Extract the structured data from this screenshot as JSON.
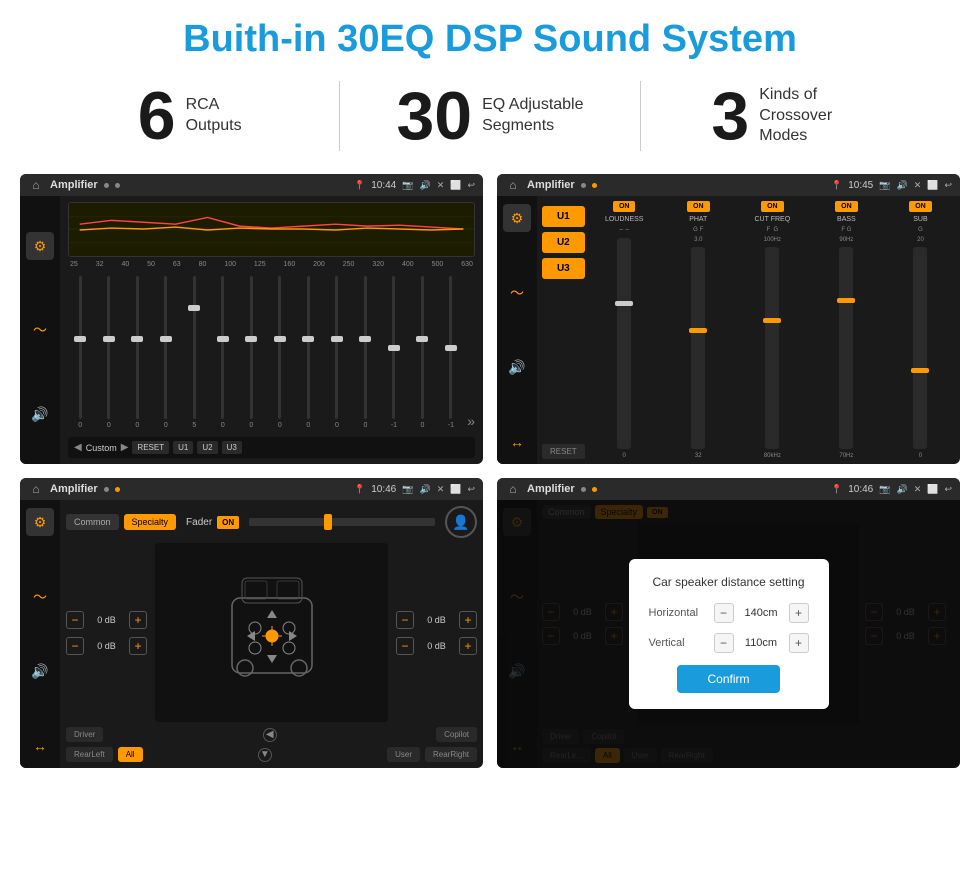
{
  "header": {
    "title": "Buith-in 30EQ DSP Sound System"
  },
  "stats": [
    {
      "number": "6",
      "label": "RCA\nOutputs"
    },
    {
      "number": "30",
      "label": "EQ Adjustable\nSegments"
    },
    {
      "number": "3",
      "label": "Kinds of\nCrossover Modes"
    }
  ],
  "screens": [
    {
      "id": "eq",
      "statusBar": {
        "title": "Amplifier",
        "time": "10:44"
      }
    },
    {
      "id": "crossover",
      "statusBar": {
        "title": "Amplifier",
        "time": "10:45"
      }
    },
    {
      "id": "fader",
      "statusBar": {
        "title": "Amplifier",
        "time": "10:46"
      }
    },
    {
      "id": "dialog",
      "statusBar": {
        "title": "Amplifier",
        "time": "10:46"
      },
      "dialog": {
        "title": "Car speaker distance setting",
        "horizontal_label": "Horizontal",
        "horizontal_value": "140cm",
        "vertical_label": "Vertical",
        "vertical_value": "110cm",
        "confirm_label": "Confirm"
      }
    }
  ],
  "eq": {
    "frequencies": [
      "25",
      "32",
      "40",
      "50",
      "63",
      "80",
      "100",
      "125",
      "160",
      "200",
      "250",
      "320",
      "400",
      "500",
      "630"
    ],
    "values": [
      "0",
      "0",
      "0",
      "0",
      "5",
      "0",
      "0",
      "0",
      "0",
      "0",
      "0",
      "0",
      "0",
      "-1",
      "0",
      "-1"
    ],
    "preset": "Custom",
    "buttons": [
      "RESET",
      "U1",
      "U2",
      "U3"
    ]
  },
  "crossover": {
    "u_buttons": [
      "U1",
      "U2",
      "U3"
    ],
    "channels": [
      "LOUDNESS",
      "PHAT",
      "CUT FREQ",
      "BASS",
      "SUB"
    ],
    "reset_label": "RESET"
  },
  "fader": {
    "tabs": [
      "Common",
      "Specialty"
    ],
    "fader_label": "Fader",
    "on_label": "ON",
    "vol_left_top": "0 dB",
    "vol_left_bottom": "0 dB",
    "vol_right_top": "0 dB",
    "vol_right_bottom": "0 dB",
    "bottom_buttons": [
      "Driver",
      "Copilot",
      "RearLeft",
      "All",
      "User",
      "RearRight"
    ]
  }
}
